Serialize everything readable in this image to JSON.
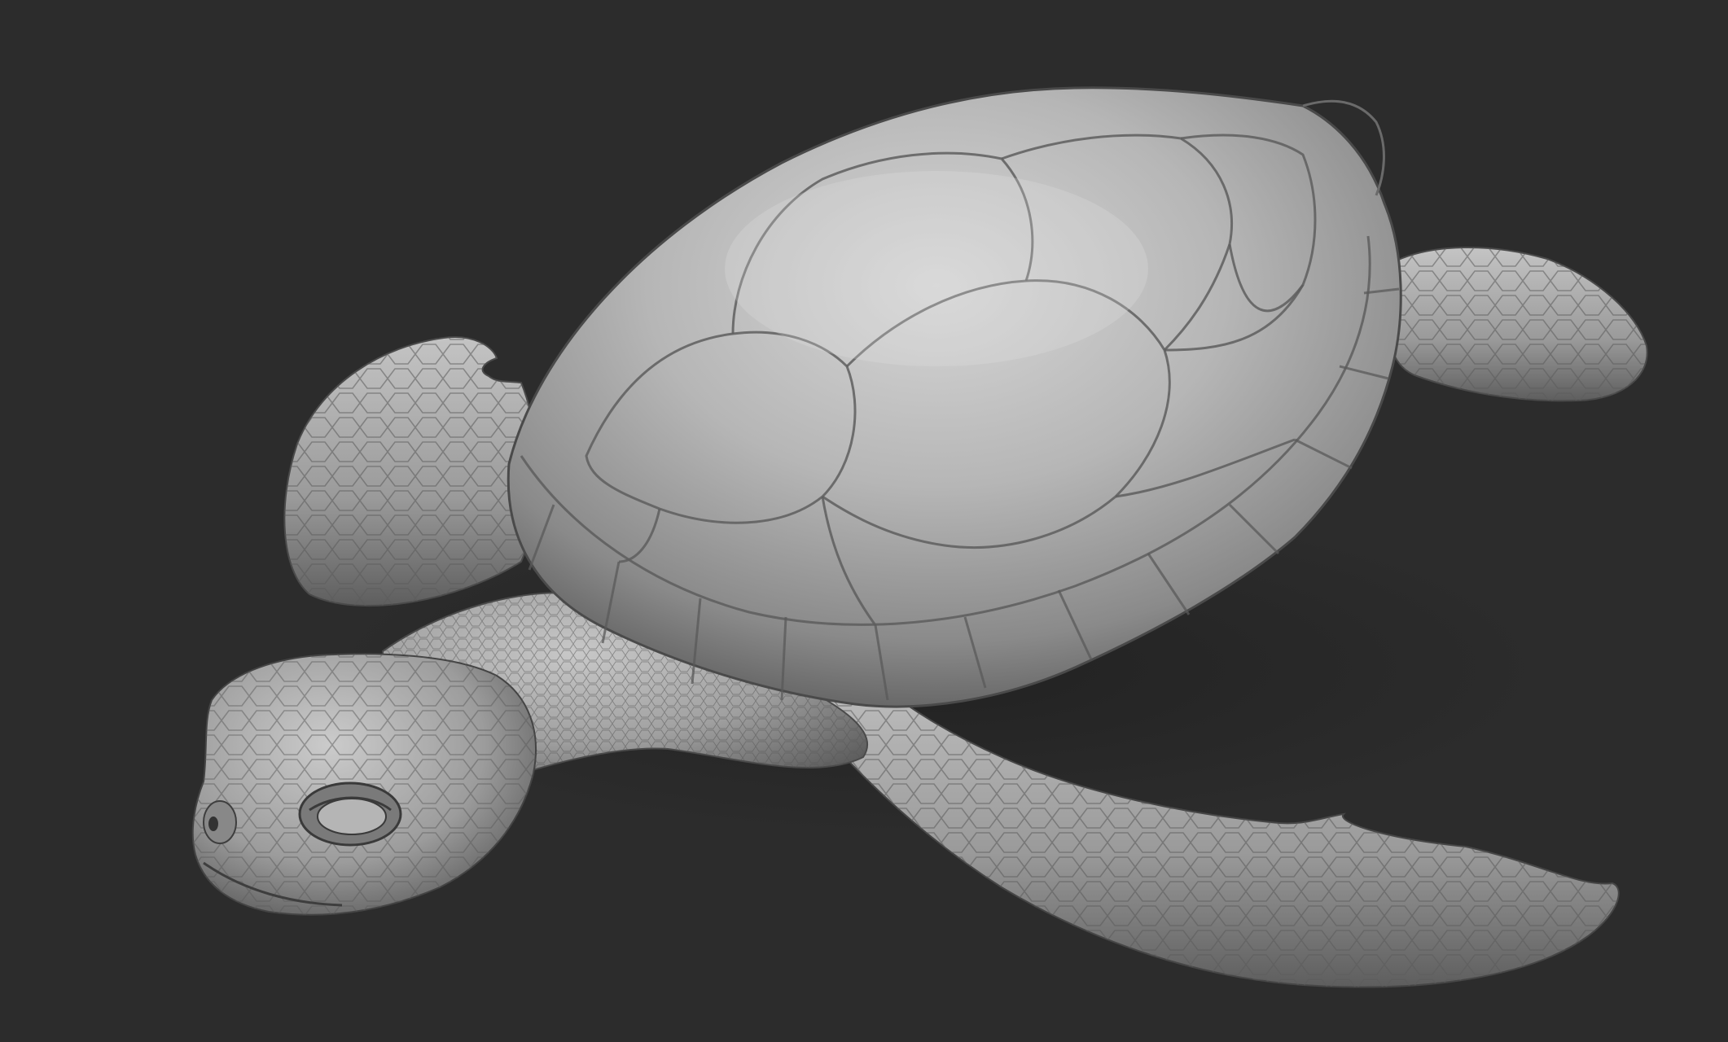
{
  "viewport": {
    "background_color": "#2c2c2c",
    "subject": "sea-turtle-sculpt",
    "material_base": "#8e8e8e",
    "material_highlight": "#d4d4d4",
    "material_shadow": "#3e3e3e",
    "cavity_line": "#555555"
  }
}
